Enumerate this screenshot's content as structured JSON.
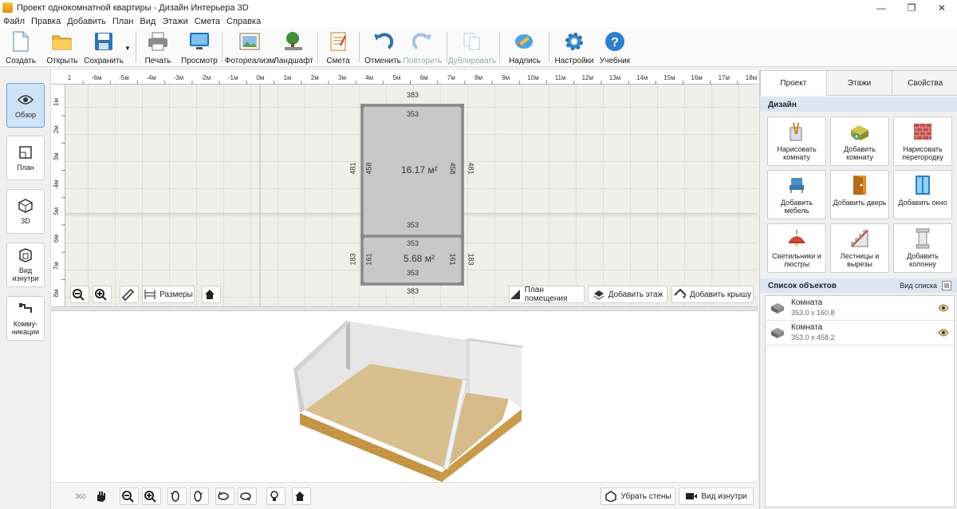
{
  "window": {
    "title": "Проект однокомнатной квартиры - Дизайн Интерьера 3D",
    "minimize": "—",
    "maximize": "❐",
    "close": "✕"
  },
  "menu": [
    "Файл",
    "Правка",
    "Добавить",
    "План",
    "Вид",
    "Этажи",
    "Смета",
    "Справка"
  ],
  "toolbar": {
    "create": "Создать",
    "open": "Открыть",
    "save": "Сохранить",
    "print": "Печать",
    "preview": "Просмотр",
    "photoreal": "Фотореализм",
    "landscape": "Ландшафт",
    "estimate": "Смета",
    "undo": "Отменить",
    "redo": "Повторить",
    "duplicate": "Дублировать",
    "label": "Надпись",
    "settings": "Настройки",
    "tutorial": "Учебник"
  },
  "left": {
    "overview": "Обзор",
    "plan": "План",
    "view3d": "3D",
    "inside": "Вид изнутри",
    "utilities": "Комму-никации"
  },
  "ruler": {
    "h": [
      "1",
      "-6м",
      "-5м",
      "-4м",
      "-3м",
      "-2м",
      "-1м",
      "0м",
      "1м",
      "2м",
      "3м",
      "4м",
      "5м",
      "6м",
      "7м",
      "8м",
      "9м",
      "10м",
      "11м",
      "12м",
      "13м",
      "14м",
      "15м",
      "16м",
      "17м",
      "18м"
    ],
    "v": [
      "1м",
      "2м",
      "3м",
      "4м",
      "5м",
      "6м",
      "7м",
      "8м"
    ]
  },
  "plan": {
    "top_outer": "383",
    "room1_top": "353",
    "room1_bottom": "353",
    "room1_left_outer": "481",
    "room1_left_inner": "458",
    "room1_right_inner": "458",
    "room1_right_outer": "481",
    "room1_area": "16.17 м²",
    "room2_top": "353",
    "room2_bottom": "353",
    "room2_left_outer": "183",
    "room2_left_inner": "161",
    "room2_right_inner": "161",
    "room2_right_outer": "183",
    "room2_area": "5.68 м²",
    "bottom_outer": "383"
  },
  "planbar": {
    "dimensions": "Размеры",
    "room_plan": "План помещения",
    "add_floor": "Добавить этаж",
    "add_roof": "Добавить крышу"
  },
  "bottom": {
    "remove_walls": "Убрать стены",
    "inside_view": "Вид изнутри",
    "rot360": "360"
  },
  "right": {
    "tabs": [
      "Проект",
      "Этажи",
      "Свойства"
    ],
    "design_header": "Дизайн",
    "buttons": {
      "draw_room": "Нарисовать комнату",
      "add_room": "Добавить комнату",
      "draw_partition": "Нарисовать перегородку",
      "add_furniture": "Добавить мебель",
      "add_door": "Добавить дверь",
      "add_window": "Добавить окно",
      "lights": "Светильники и люстры",
      "stairs": "Лестницы и вырезы",
      "column": "Добавить колонну"
    },
    "list_header": "Список объектов",
    "list_view": "Вид списка",
    "objects": [
      {
        "name": "Комната",
        "size": "353.0 x 160.8"
      },
      {
        "name": "Комната",
        "size": "353.0 x 458.2"
      }
    ]
  },
  "colors": {
    "accent": "#cfe3f7",
    "floor": "#d9bf8e",
    "brick": "#c99a4a",
    "wall": "#e6e6e6"
  }
}
